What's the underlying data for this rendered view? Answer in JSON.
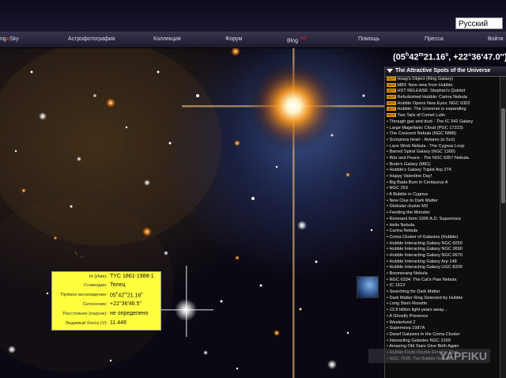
{
  "language_select": {
    "value": "Русский"
  },
  "nav": {
    "logo_part1": "ng",
    "logo_part2": "Sky",
    "items": [
      "Астрофотография",
      "Коллекция",
      "Форум",
      "Blog",
      "Помощь",
      "Пресса",
      "Войти"
    ],
    "blog_badge": "new"
  },
  "coordinates": {
    "ra_h": "05",
    "ra_h_unit": "h",
    "ra_m": "42",
    "ra_m_unit": "m",
    "ra_s": "21.16",
    "ra_s_unit": "s",
    "dec": ", +22°36′47.0″)",
    "open": "("
  },
  "panel": {
    "title": "The Attractive Spots of the Universe",
    "hot_label": "HOT",
    "items": [
      {
        "hot": true,
        "text": "Hoag's Object (Ring Galaxy)"
      },
      {
        "hot": true,
        "text": "M83: New view from Hubble"
      },
      {
        "hot": true,
        "text": "HST RELEASE: Stephan's Quintet"
      },
      {
        "hot": true,
        "text": "Refurbished Hubble: Carina Nebula"
      },
      {
        "hot": true,
        "text": "Hubble Opens New Eyes: NGC 6302"
      },
      {
        "hot": true,
        "text": "Hubble: The Universe is expanding"
      },
      {
        "hot": true,
        "text": "Two Tails of Comet Lulin"
      },
      {
        "hot": false,
        "text": "Through gas and dust - The IC 342 Galaxy"
      },
      {
        "hot": false,
        "text": "Large Magellanic Cloud (PGC 17223)"
      },
      {
        "hot": false,
        "text": "The Crescent Nebula (NGC 6888)"
      },
      {
        "hot": false,
        "text": "Scorpions heart - Antares (α Sco)"
      },
      {
        "hot": false,
        "text": "Lace Work Nebula - The Cygnus Loop"
      },
      {
        "hot": false,
        "text": "Barred Spiral Galaxy (NGC 1300)"
      },
      {
        "hot": false,
        "text": "War and Peace - The NGC 6357 Nebula."
      },
      {
        "hot": false,
        "text": "Bode's Galaxy (M81)"
      },
      {
        "hot": false,
        "text": "Hubble's Galaxy Triplet Arp 274"
      },
      {
        "hot": false,
        "text": "Happy Valentine Day!"
      },
      {
        "hot": false,
        "text": "Big Bada Bum in Centaurus A"
      },
      {
        "hot": false,
        "text": "NGC 253"
      },
      {
        "hot": false,
        "text": "A Bubble in Cygnus"
      },
      {
        "hot": false,
        "text": "New Clue to Dark Matter"
      },
      {
        "hot": false,
        "text": "Globular cluster M3"
      },
      {
        "hot": false,
        "text": "Feeding the Monster"
      },
      {
        "hot": false,
        "text": "Remnant from 1006 A.D. Supernova"
      },
      {
        "hot": false,
        "text": "Helix Nebula"
      },
      {
        "hot": false,
        "text": "Carina Nebula"
      },
      {
        "hot": false,
        "text": "Coma Cluster of Galaxies (Hubble)"
      },
      {
        "hot": false,
        "text": "Hubble Interacting Galaxy NGC 6050"
      },
      {
        "hot": false,
        "text": "Hubble Interacting Galaxy NGC 3690"
      },
      {
        "hot": false,
        "text": "Hubble Interacting Galaxy NGC 6670"
      },
      {
        "hot": false,
        "text": "Hubble Interacting Galaxy Arp 148"
      },
      {
        "hot": false,
        "text": "Hubble Interacting Galaxy UGC 8335"
      },
      {
        "hot": false,
        "text": "Boomerang Nebula"
      },
      {
        "hot": false,
        "text": "NGC 6334: The Cat's Paw Nebula"
      },
      {
        "hot": false,
        "text": "IC 1613"
      },
      {
        "hot": false,
        "text": "Searching for Dark Matter"
      },
      {
        "hot": false,
        "text": "Dark Matter Ring Detected by Hubble"
      },
      {
        "hot": false,
        "text": "Long Stem Rosette"
      },
      {
        "hot": false,
        "text": "12.8 billion light-years away..."
      },
      {
        "hot": false,
        "text": "A Ghostly Presence"
      },
      {
        "hot": false,
        "text": "Westerlund 2"
      },
      {
        "hot": false,
        "text": "Supernova 1987A"
      },
      {
        "hot": false,
        "text": "Dwarf Galaxies in the Coma Cluster"
      },
      {
        "hot": false,
        "text": "Interacting Galaxies NGC 3169"
      },
      {
        "hot": false,
        "text": "Amazing Old Stars Give Birth Again"
      },
      {
        "hot": false,
        "text": "Hubble Finds Double Einstein Ring"
      },
      {
        "hot": false,
        "text": "NGC 7635: The Bubble Nebula"
      }
    ]
  },
  "info": {
    "id_label": "Id (Имя):",
    "id_value": "TYC 1861-1988-1",
    "constellation_label": "Созвездие:",
    "constellation_value": "Телец",
    "ra_label": "Прямое восхождение:",
    "ra_h": "05",
    "ra_h_unit": "h",
    "ra_m": "42",
    "ra_m_unit": "m",
    "ra_s": "21.16",
    "ra_s_unit": "s",
    "dec_label": "Склонение:",
    "dec_value": "+22°36′46.5″",
    "distance_label": "Расстояние (парсек):",
    "distance_value": "не определено",
    "magnitude_label": "Видимый блеск (V):",
    "magnitude_value": "11.448"
  },
  "watermark": "YAPFIKU"
}
